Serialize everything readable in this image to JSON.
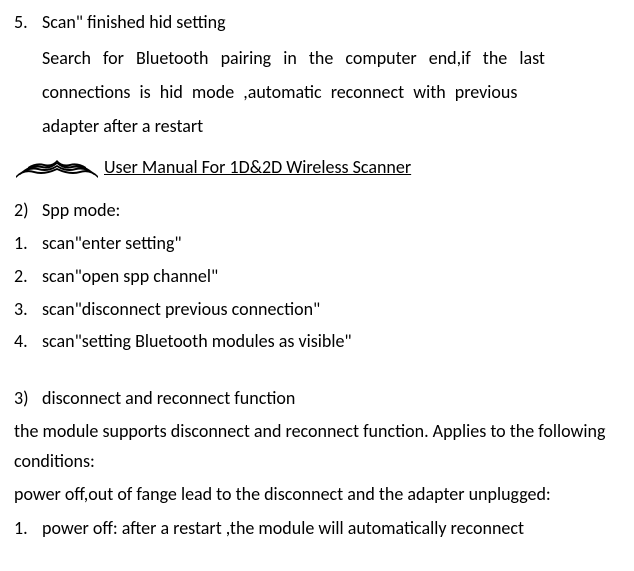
{
  "top_item": {
    "num": "5.",
    "line1": "Scan\" finished hid setting",
    "desc_line1": "Search for Bluetooth pairing in the computer end,if the last",
    "desc_line2": "connections is hid mode ,automatic reconnect with previous",
    "desc_line3": "adapter after a restart"
  },
  "header": {
    "title": "User Manual For 1D&2D Wireless Scanner"
  },
  "section2": {
    "num": "2)",
    "label": "Spp mode:",
    "items": [
      {
        "num": "1.",
        "text": "scan\"enter setting\""
      },
      {
        "num": "2.",
        "text": "scan\"open spp channel\""
      },
      {
        "num": "3.",
        "text": "scan\"disconnect previous connection\""
      },
      {
        "num": "4.",
        "text": "scan\"setting Bluetooth modules as visible\""
      }
    ]
  },
  "section3": {
    "num": "3)",
    "label": "disconnect and reconnect function",
    "para1": "the module supports disconnect and reconnect function. Applies to the following conditions:",
    "para2": "power off,out of fange lead to the disconnect and the adapter unplugged:",
    "item1": {
      "num": "1.",
      "text": "power off: after a restart ,the module will automatically reconnect"
    }
  }
}
